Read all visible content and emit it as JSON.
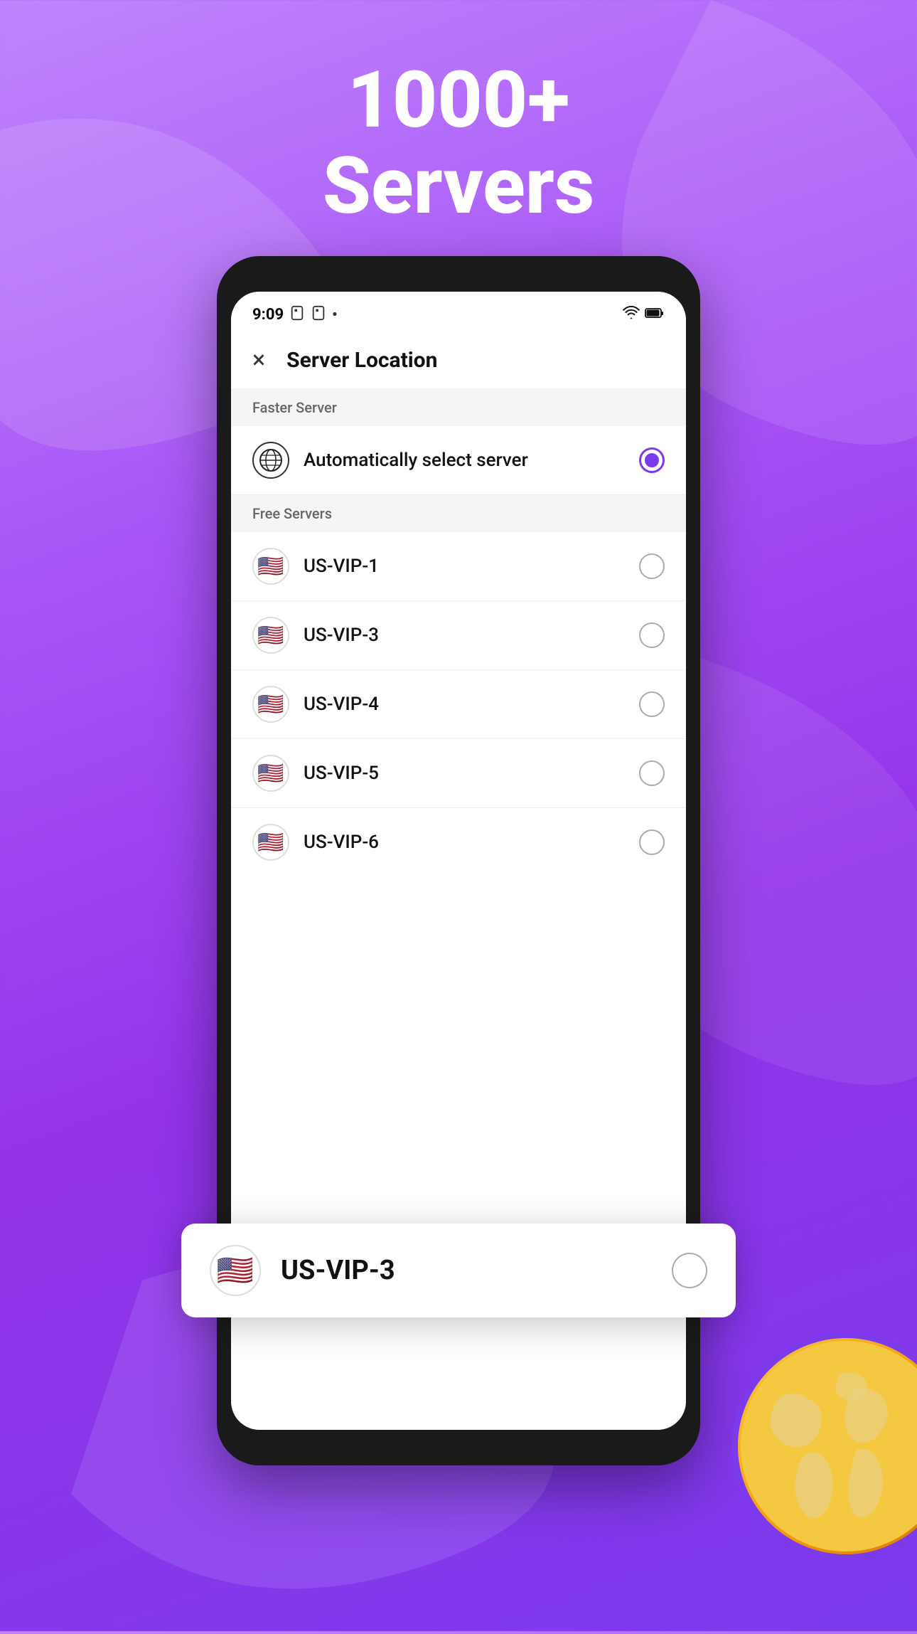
{
  "background": {
    "gradient_start": "#c084fc",
    "gradient_end": "#7c3aed"
  },
  "header": {
    "title_line1": "1000+",
    "title_line2": "Servers"
  },
  "status_bar": {
    "time": "9:09",
    "dot": "•",
    "wifi_icon": "wifi",
    "battery_icon": "battery"
  },
  "app_bar": {
    "close_label": "×",
    "title": "Server Location"
  },
  "sections": [
    {
      "label": "Faster Server",
      "items": [
        {
          "id": "auto",
          "name": "Automatically select server",
          "icon_type": "globe",
          "selected": true
        }
      ]
    },
    {
      "label": "Free Servers",
      "items": [
        {
          "id": "us-vip-1",
          "name": "US-VIP-1",
          "icon_type": "us-flag",
          "selected": false
        },
        {
          "id": "us-vip-3-highlight",
          "name": "US-VIP-3",
          "icon_type": "us-flag",
          "selected": false,
          "highlighted": true
        },
        {
          "id": "us-vip-3",
          "name": "US-VIP-3",
          "icon_type": "us-flag",
          "selected": false
        },
        {
          "id": "us-vip-4",
          "name": "US-VIP-4",
          "icon_type": "us-flag",
          "selected": false
        },
        {
          "id": "us-vip-5",
          "name": "US-VIP-5",
          "icon_type": "us-flag",
          "selected": false
        },
        {
          "id": "us-vip-6",
          "name": "US-VIP-6",
          "icon_type": "us-flag",
          "selected": false
        }
      ]
    }
  ],
  "floating_item": {
    "name": "US-VIP-3",
    "icon_type": "us-flag"
  }
}
